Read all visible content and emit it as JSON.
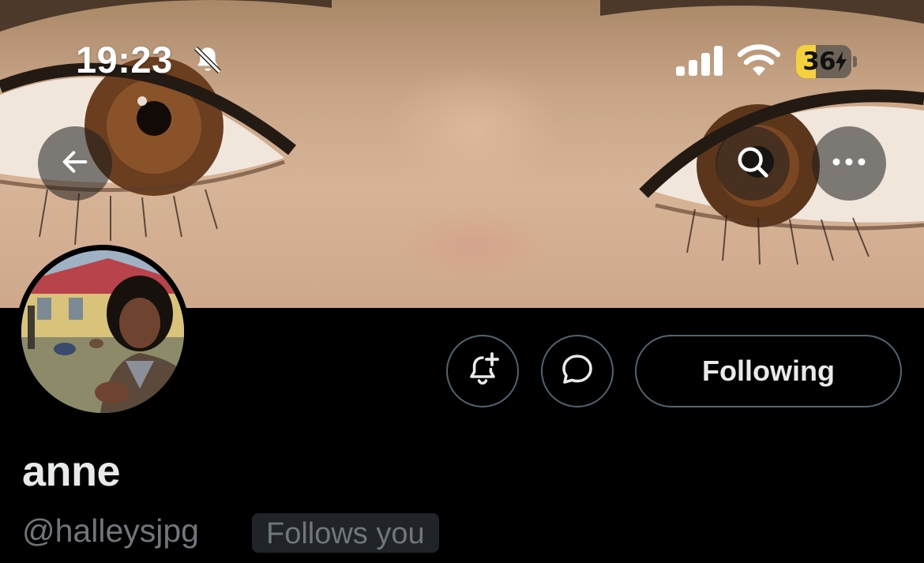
{
  "status_bar": {
    "time": "19:23",
    "battery_percent": "36",
    "battery_level": 0.36,
    "battery_color": "#f5d23d",
    "icons": [
      "bell-slash-icon",
      "cellular-signal-icon",
      "wifi-icon",
      "battery-charging-icon"
    ]
  },
  "header": {
    "back_icon": "arrow-left-icon",
    "search_icon": "search-icon",
    "more_icon": "ellipsis-icon"
  },
  "profile": {
    "display_name": "anne",
    "handle": "@halleysjpg",
    "follows_you_label": "Follows you",
    "follow_button_label": "Following",
    "notify_icon": "bell-plus-icon",
    "message_icon": "chat-bubble-icon"
  },
  "colors": {
    "background": "#000000",
    "primary_text": "#e7e9ea",
    "secondary_text": "#71767b",
    "border": "#536471",
    "badge_bg": "#202327"
  }
}
